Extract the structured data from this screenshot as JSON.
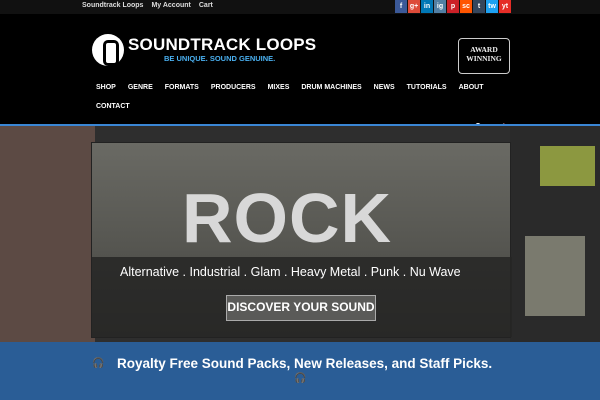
{
  "topbar": {
    "links": [
      "Soundtrack Loops",
      "My Account",
      "Cart"
    ],
    "social": [
      "f",
      "g+",
      "in",
      "ig",
      "p",
      "sc",
      "t",
      "tw",
      "yt"
    ]
  },
  "header": {
    "brand": "SOUNDTRACK LOOPS",
    "tagline": "BE UNIQUE. SOUND GENUINE.",
    "award_line1": "AWARD",
    "award_line2": "WINNING"
  },
  "nav": {
    "items": [
      "SHOP",
      "GENRE",
      "FORMATS",
      "PRODUCERS",
      "MIXES",
      "DRUM MACHINES",
      "NEWS",
      "TUTORIALS",
      "ABOUT"
    ],
    "second_row": "CONTACT"
  },
  "hero": {
    "title": "ROCK",
    "genres": "Alternative . Industrial . Glam . Heavy Metal . Punk . Nu Wave",
    "cta": "DISCOVER YOUR SOUND"
  },
  "banner": {
    "text": "Royalty Free Sound Packs, New Releases, and Staff Picks."
  },
  "colors": {
    "accent": "#3a86d4",
    "banner_bg": "#2a5d96",
    "tagline": "#4ab0f0"
  }
}
